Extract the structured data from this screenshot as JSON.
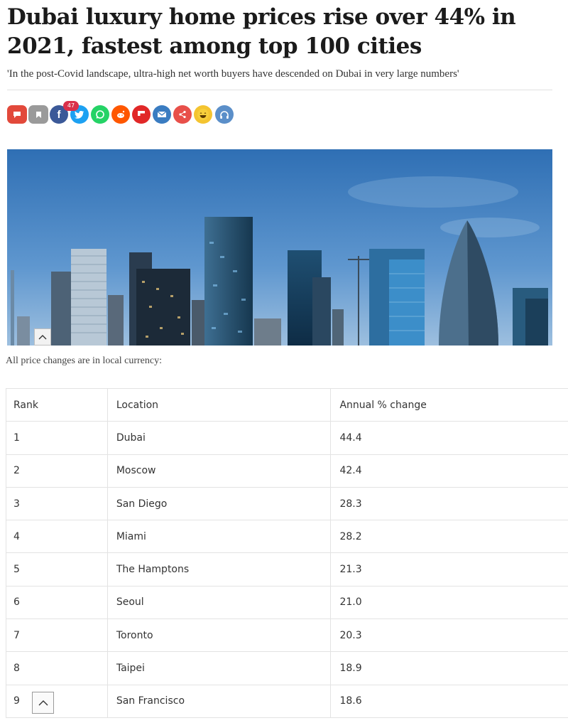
{
  "article": {
    "headline": "Dubai luxury home prices rise over 44% in 2021, fastest among top 100 cities",
    "standfirst": "'In the post-Covid landscape, ultra-high net worth buyers have descended on Dubai in very large numbers'"
  },
  "share_bar": {
    "comment_count": "47",
    "buttons": [
      {
        "icon": "comment-icon",
        "color": "#e2493b"
      },
      {
        "icon": "bookmark-icon",
        "color": "#9a9a9a"
      },
      {
        "icon": "facebook-icon",
        "color": "#3b5998",
        "glyph": "f"
      },
      {
        "icon": "twitter-icon",
        "color": "#1da1f2"
      },
      {
        "icon": "whatsapp-icon",
        "color": "#25d366"
      },
      {
        "icon": "reddit-icon",
        "color": "#ff5700"
      },
      {
        "icon": "flipboard-icon",
        "color": "#e12828"
      },
      {
        "icon": "email-icon",
        "color": "#3a7cc1"
      },
      {
        "icon": "share-icon",
        "color": "#e8504a"
      },
      {
        "icon": "laugh-emoji-icon",
        "color": "#f4c430"
      },
      {
        "icon": "headphones-icon",
        "color": "#5b8fc9"
      }
    ]
  },
  "photo": {
    "icon": "city-skyline-photo"
  },
  "caption": "All price changes are in local currency:",
  "table": {
    "headers": [
      "Rank",
      "Location",
      "Annual % change"
    ],
    "rows": [
      [
        "1",
        "Dubai",
        "44.4"
      ],
      [
        "2",
        "Moscow",
        "42.4"
      ],
      [
        "3",
        "San Diego",
        "28.3"
      ],
      [
        "4",
        "Miami",
        "28.2"
      ],
      [
        "5",
        "The Hamptons",
        "21.3"
      ],
      [
        "6",
        "Seoul",
        "21.0"
      ],
      [
        "7",
        "Toronto",
        "20.3"
      ],
      [
        "8",
        "Taipei",
        "18.9"
      ],
      [
        "9",
        "San Francisco",
        "18.6"
      ]
    ]
  }
}
